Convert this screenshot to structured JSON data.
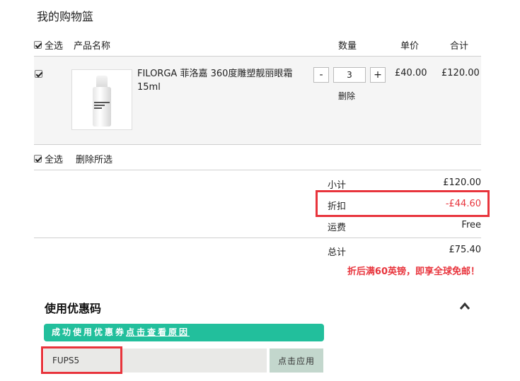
{
  "page": {
    "title": "我的购物篮"
  },
  "header": {
    "select_all": "全选",
    "product_name": "产品名称",
    "quantity": "数量",
    "unit_price": "单价",
    "total": "合计"
  },
  "item": {
    "name": "FILORGA 菲洛嘉 360度雕塑靓丽眼霜15ml",
    "quantity": "3",
    "minus": "-",
    "plus": "+",
    "delete": "删除",
    "unit_price": "£40.00",
    "total": "£120.00",
    "checked": true
  },
  "footer_select": {
    "select_all": "全选",
    "delete_selected": "删除所选"
  },
  "summary": {
    "subtotal_label": "小计",
    "subtotal_value": "£120.00",
    "discount_label": "折扣",
    "discount_value": "-£44.60",
    "shipping_label": "运费",
    "shipping_value": "Free",
    "total_label": "总计",
    "total_value": "£75.40",
    "promo_note": "折后满60英镑，即享全球免邮！"
  },
  "coupon": {
    "title": "使用优惠码",
    "success_text": "成功使用优惠券",
    "success_link": "点击查看原因",
    "code_value": "FUPS5",
    "apply_label": "点击应用"
  },
  "colors": {
    "accent_red": "#e8343c",
    "success_green": "#22bf9c",
    "apply_button": "#c3d7cd"
  }
}
